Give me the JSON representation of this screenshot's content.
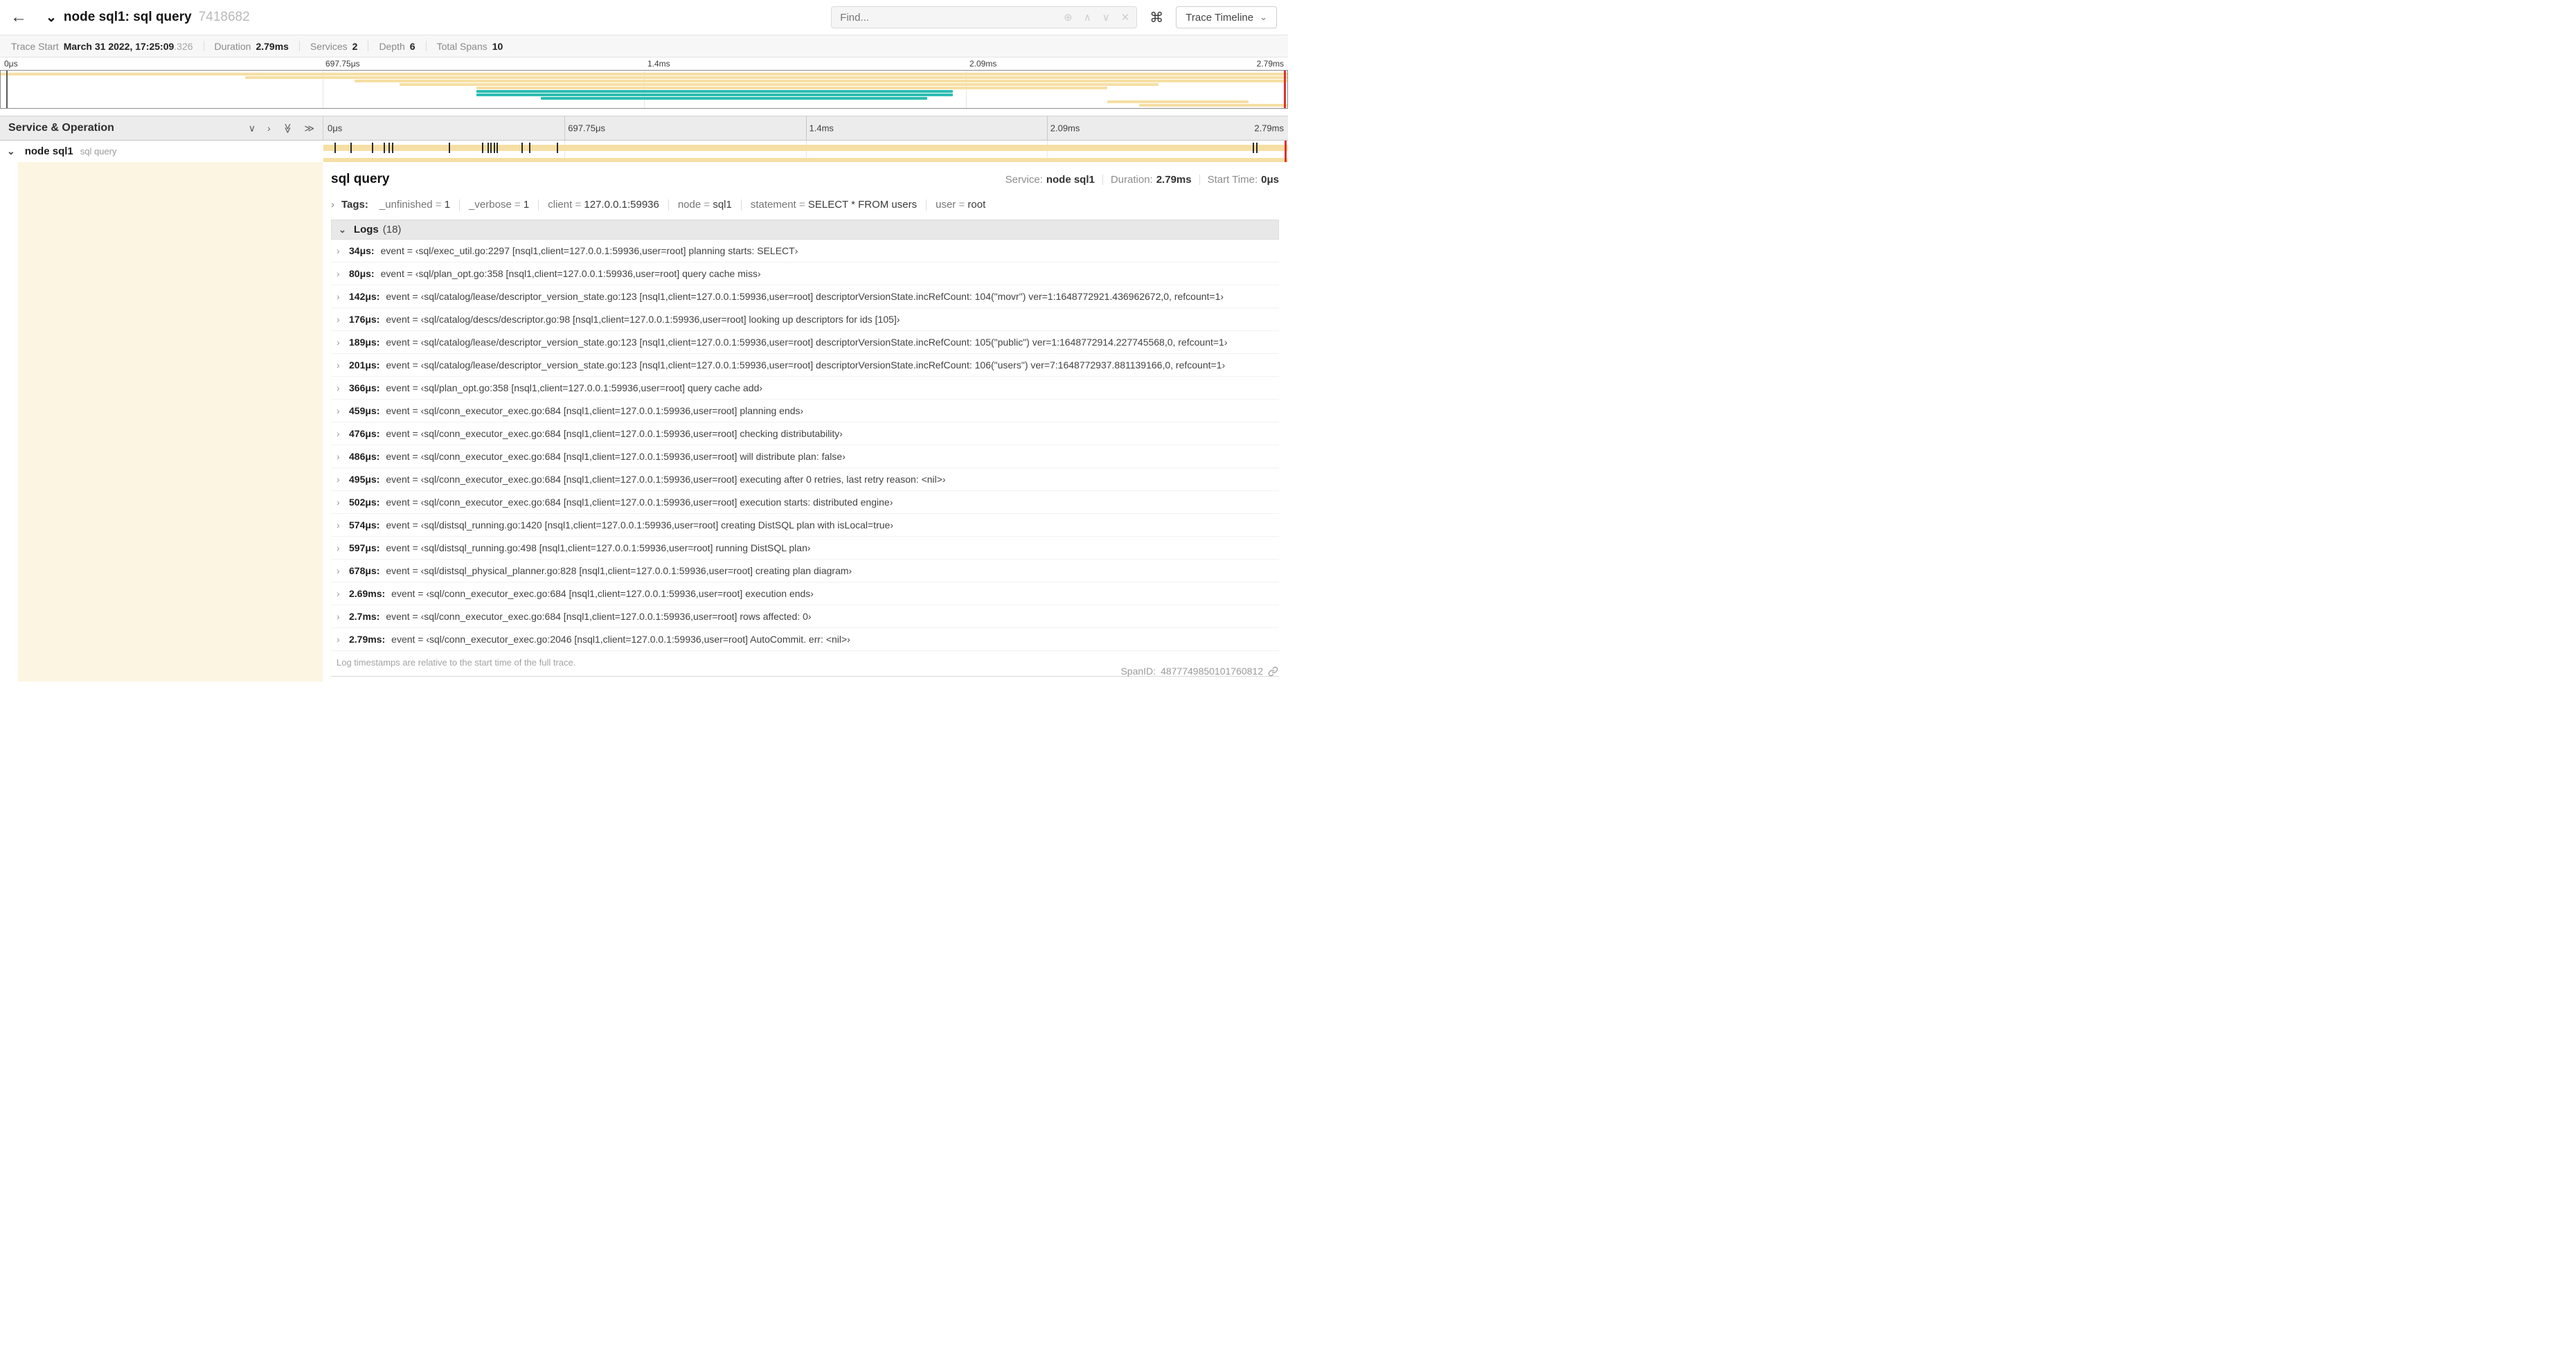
{
  "icons": {
    "back": "←",
    "chevron_down": "⌄",
    "chevron_right": "›",
    "find_focus": "⊕",
    "up": "∧",
    "down": "∨",
    "clear": "✕",
    "command": "⌘",
    "collapse_one": "∨",
    "expand_one": "›",
    "double_chevron": "≫"
  },
  "header": {
    "title": "node sql1: sql query",
    "trace_id": "7418682",
    "find_placeholder": "Find...",
    "view_button": "Trace Timeline"
  },
  "summary": [
    {
      "label": "Trace Start",
      "value": "March 31 2022, 17:25:09",
      "muted": ".326"
    },
    {
      "label": "Duration",
      "value": "2.79ms"
    },
    {
      "label": "Services",
      "value": "2"
    },
    {
      "label": "Depth",
      "value": "6"
    },
    {
      "label": "Total Spans",
      "value": "10"
    }
  ],
  "ticks": [
    "0μs",
    "697.75μs",
    "1.4ms",
    "2.09ms",
    "2.79ms"
  ],
  "colors": {
    "span_tan": "#f6dfa4",
    "span_teal": "#2bbdb2",
    "accent_red": "#e03131",
    "indent_cream": "#fcf5e2"
  },
  "minimap": {
    "spans": [
      {
        "row": 0,
        "start": 0,
        "end": 100,
        "color": "#f6dfa4"
      },
      {
        "row": 1,
        "start": 19,
        "end": 100,
        "color": "#f6dfa4"
      },
      {
        "row": 2,
        "start": 27.5,
        "end": 100,
        "color": "#f6dfa4"
      },
      {
        "row": 3,
        "start": 31,
        "end": 90,
        "color": "#f6dfa4"
      },
      {
        "row": 4,
        "start": 37,
        "end": 86,
        "color": "#f6dfa4"
      },
      {
        "row": 5,
        "start": 37,
        "end": 74,
        "color": "#2bbdb2"
      },
      {
        "row": 6,
        "start": 37,
        "end": 74,
        "color": "#2bbdb2"
      },
      {
        "row": 7,
        "start": 42,
        "end": 72,
        "color": "#2bbdb2"
      },
      {
        "row": 8,
        "start": 86,
        "end": 97,
        "color": "#f6dfa4"
      },
      {
        "row": 9,
        "start": 88.5,
        "end": 100,
        "color": "#f6dfa4"
      }
    ]
  },
  "timeline": {
    "left_header": "Service & Operation",
    "row": {
      "service": "node sql1",
      "operation": "sql query",
      "color": "#f6dfa4"
    },
    "log_markers": [
      1.2,
      2.9,
      5.1,
      6.3,
      6.8,
      7.2,
      13.1,
      16.5,
      17.1,
      17.4,
      17.7,
      18.0,
      20.6,
      21.4,
      24.3,
      96.4,
      96.8,
      99.7
    ]
  },
  "detail": {
    "title": "sql query",
    "meta": [
      {
        "label": "Service:",
        "value": "node sql1"
      },
      {
        "label": "Duration:",
        "value": "2.79ms"
      },
      {
        "label": "Start Time:",
        "value": "0μs"
      }
    ],
    "tags_label": "Tags:",
    "tags": [
      {
        "key": "_unfinished",
        "value": "1"
      },
      {
        "key": "_verbose",
        "value": "1"
      },
      {
        "key": "client",
        "value": "127.0.0.1:59936"
      },
      {
        "key": "node",
        "value": "sql1"
      },
      {
        "key": "statement",
        "value": "SELECT * FROM users"
      },
      {
        "key": "user",
        "value": "root"
      }
    ],
    "logs_label": "Logs",
    "logs_count": "(18)",
    "logs": [
      {
        "time": "34μs:",
        "text": "event = ‹sql/exec_util.go:2297 [nsql1,client=127.0.0.1:59936,user=root] planning starts: SELECT›"
      },
      {
        "time": "80μs:",
        "text": "event = ‹sql/plan_opt.go:358 [nsql1,client=127.0.0.1:59936,user=root] query cache miss›"
      },
      {
        "time": "142μs:",
        "text": "event = ‹sql/catalog/lease/descriptor_version_state.go:123 [nsql1,client=127.0.0.1:59936,user=root] descriptorVersionState.incRefCount: 104(\"movr\") ver=1:1648772921.436962672,0, refcount=1›"
      },
      {
        "time": "176μs:",
        "text": "event = ‹sql/catalog/descs/descriptor.go:98 [nsql1,client=127.0.0.1:59936,user=root] looking up descriptors for ids [105]›"
      },
      {
        "time": "189μs:",
        "text": "event = ‹sql/catalog/lease/descriptor_version_state.go:123 [nsql1,client=127.0.0.1:59936,user=root] descriptorVersionState.incRefCount: 105(\"public\") ver=1:1648772914.227745568,0, refcount=1›"
      },
      {
        "time": "201μs:",
        "text": "event = ‹sql/catalog/lease/descriptor_version_state.go:123 [nsql1,client=127.0.0.1:59936,user=root] descriptorVersionState.incRefCount: 106(\"users\") ver=7:1648772937.881139166,0, refcount=1›"
      },
      {
        "time": "366μs:",
        "text": "event = ‹sql/plan_opt.go:358 [nsql1,client=127.0.0.1:59936,user=root] query cache add›"
      },
      {
        "time": "459μs:",
        "text": "event = ‹sql/conn_executor_exec.go:684 [nsql1,client=127.0.0.1:59936,user=root] planning ends›"
      },
      {
        "time": "476μs:",
        "text": "event = ‹sql/conn_executor_exec.go:684 [nsql1,client=127.0.0.1:59936,user=root] checking distributability›"
      },
      {
        "time": "486μs:",
        "text": "event = ‹sql/conn_executor_exec.go:684 [nsql1,client=127.0.0.1:59936,user=root] will distribute plan: false›"
      },
      {
        "time": "495μs:",
        "text": "event = ‹sql/conn_executor_exec.go:684 [nsql1,client=127.0.0.1:59936,user=root] executing after 0 retries, last retry reason: <nil>›"
      },
      {
        "time": "502μs:",
        "text": "event = ‹sql/conn_executor_exec.go:684 [nsql1,client=127.0.0.1:59936,user=root] execution starts: distributed engine›"
      },
      {
        "time": "574μs:",
        "text": "event = ‹sql/distsql_running.go:1420 [nsql1,client=127.0.0.1:59936,user=root] creating DistSQL plan with isLocal=true›"
      },
      {
        "time": "597μs:",
        "text": "event = ‹sql/distsql_running.go:498 [nsql1,client=127.0.0.1:59936,user=root] running DistSQL plan›"
      },
      {
        "time": "678μs:",
        "text": "event = ‹sql/distsql_physical_planner.go:828 [nsql1,client=127.0.0.1:59936,user=root] creating plan diagram›"
      },
      {
        "time": "2.69ms:",
        "text": "event = ‹sql/conn_executor_exec.go:684 [nsql1,client=127.0.0.1:59936,user=root] execution ends›"
      },
      {
        "time": "2.7ms:",
        "text": "event = ‹sql/conn_executor_exec.go:684 [nsql1,client=127.0.0.1:59936,user=root] rows affected: 0›"
      },
      {
        "time": "2.79ms:",
        "text": "event = ‹sql/conn_executor_exec.go:2046 [nsql1,client=127.0.0.1:59936,user=root] AutoCommit. err: <nil>›"
      }
    ],
    "footnote": "Log timestamps are relative to the start time of the full trace.",
    "spanid_label": "SpanID:",
    "spanid": "4877749850101760812"
  }
}
